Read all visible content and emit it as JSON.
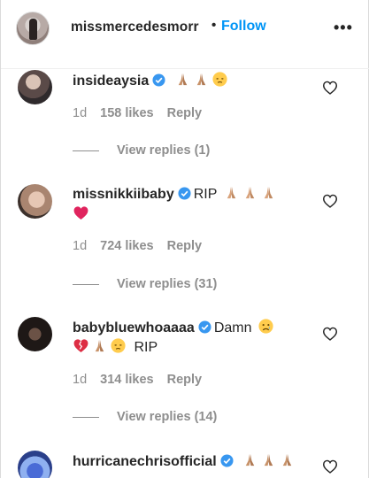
{
  "header": {
    "username": "missmercedesmorr",
    "separator": "•",
    "follow_label": "Follow",
    "more_label": "•••"
  },
  "comments": [
    {
      "username": "insideaysia",
      "text": "",
      "emojis_line1": [
        "folded-hands",
        "folded-hands",
        "pensive-face"
      ],
      "emojis_line2": [],
      "text_line2": "",
      "time": "1d",
      "likes": "158 likes",
      "reply": "Reply",
      "view_replies": "View replies (1)"
    },
    {
      "username": "missnikkiibaby",
      "text": "RIP",
      "emojis_line1": [
        "folded-hands",
        "folded-hands",
        "folded-hands"
      ],
      "emojis_line2": [
        "red-heart"
      ],
      "text_line2": "",
      "time": "1d",
      "likes": "724 likes",
      "reply": "Reply",
      "view_replies": "View replies (31)"
    },
    {
      "username": "babybluewhoaaaa",
      "text": "Damn",
      "emojis_line1": [
        "sad-face"
      ],
      "emojis_line2": [
        "broken-heart",
        "folded-hands",
        "pensive-face"
      ],
      "text_line2": "RIP",
      "time": "1d",
      "likes": "314 likes",
      "reply": "Reply",
      "view_replies": "View replies (14)"
    },
    {
      "username": "hurricanechrisofficial",
      "text": "",
      "emojis_line1": [
        "folded-hands",
        "folded-hands",
        "folded-hands"
      ],
      "emojis_line2": [],
      "text_line2": "",
      "time": "",
      "likes": "",
      "reply": "",
      "view_replies": ""
    }
  ],
  "colors": {
    "link_blue": "#0095f6",
    "verified_blue": "#3897f0",
    "muted": "#8e8e8e"
  }
}
